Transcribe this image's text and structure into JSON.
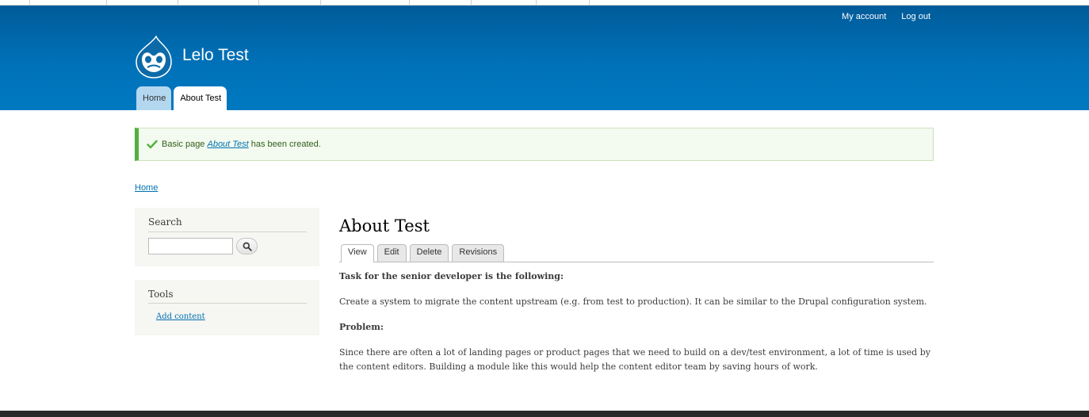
{
  "header": {
    "site_name": "Lelo Test",
    "secondary_menu": [
      {
        "label": "My account"
      },
      {
        "label": "Log out"
      }
    ],
    "main_menu": [
      {
        "label": "Home"
      },
      {
        "label": "About Test"
      }
    ],
    "logo_icon": "drupal-drop-logo",
    "accent_color": "#0071b8"
  },
  "status": {
    "prefix": "Basic page ",
    "link": "About Test",
    "suffix": " has been created.",
    "icon": "check-icon",
    "color": "#52b03c"
  },
  "breadcrumb": {
    "home": "Home"
  },
  "sidebar": {
    "search": {
      "title": "Search",
      "placeholder": "",
      "button_icon": "search-icon"
    },
    "tools": {
      "title": "Tools",
      "link": "Add content"
    }
  },
  "main": {
    "title": "About Test",
    "tabs": [
      {
        "label": "View",
        "active": true
      },
      {
        "label": "Edit",
        "active": false
      },
      {
        "label": "Delete",
        "active": false
      },
      {
        "label": "Revisions",
        "active": false
      }
    ],
    "body": {
      "heading1": "Task for the senior developer is the following:",
      "para1": "Create a system to migrate the content upstream (e.g. from test to production). It can be similar to the Drupal configuration system.",
      "heading2": "Problem:",
      "para2": "Since there are often a lot of landing pages or product pages that we need to build on a dev/test environment, a lot of time is used by the content editors. Building a module like this would help the content editor team by saving hours of work."
    }
  }
}
